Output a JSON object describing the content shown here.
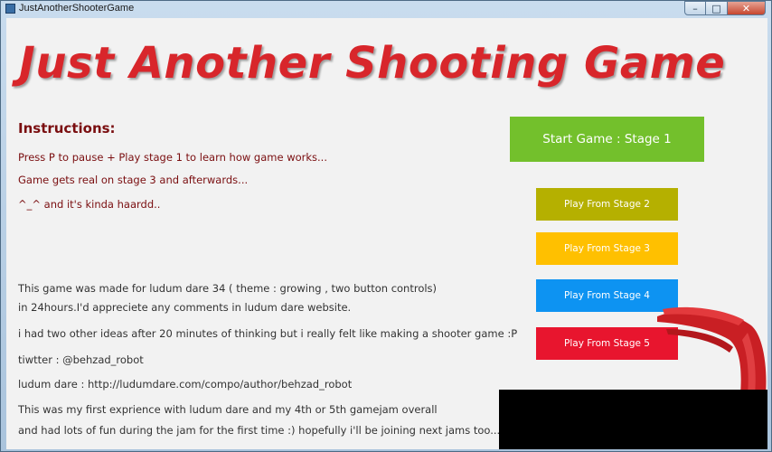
{
  "window": {
    "title": "JustAnotherShooterGame",
    "controls": {
      "minimize": "–",
      "maximize": "□",
      "close": "✕"
    }
  },
  "game": {
    "title": "Just Another Shooting Game"
  },
  "instructions": {
    "heading": "Instructions:",
    "lines": [
      "Press  P to pause + Play stage 1 to  learn how game works...",
      "Game gets real on stage 3 and afterwards...",
      "^_^ and it's kinda haardd.."
    ]
  },
  "about": {
    "lines": [
      "This game was made for ludum dare 34 ( theme : growing ,  two button controls)",
      "in 24hours.I'd appreciete any comments in ludum dare website.",
      "i had two other ideas after 20 minutes of thinking but i really felt like making a shooter game :P",
      "tiwtter : @behzad_robot",
      "ludum dare : http://ludumdare.com/compo/author/behzad_robot",
      "This was my first exprience with ludum dare and my 4th or 5th gamejam overall",
      "and had lots of fun during the jam for the first  time :) hopefully i'll be joining next jams too..."
    ]
  },
  "buttons": {
    "start": {
      "label": "Start Game : Stage 1",
      "color": "#73c02c"
    },
    "stages": [
      {
        "label": "Play From Stage 2",
        "color": "#b5b000"
      },
      {
        "label": "Play From Stage 3",
        "color": "#ffc000"
      },
      {
        "label": "Play From Stage 4",
        "color": "#0d93f2"
      },
      {
        "label": "Play From Stage 5",
        "color": "#e8152e"
      }
    ]
  },
  "colors": {
    "title": "#d8262b",
    "instructions_text": "#7a0e10",
    "body_text": "#333333",
    "background": "#f2f2f2"
  }
}
